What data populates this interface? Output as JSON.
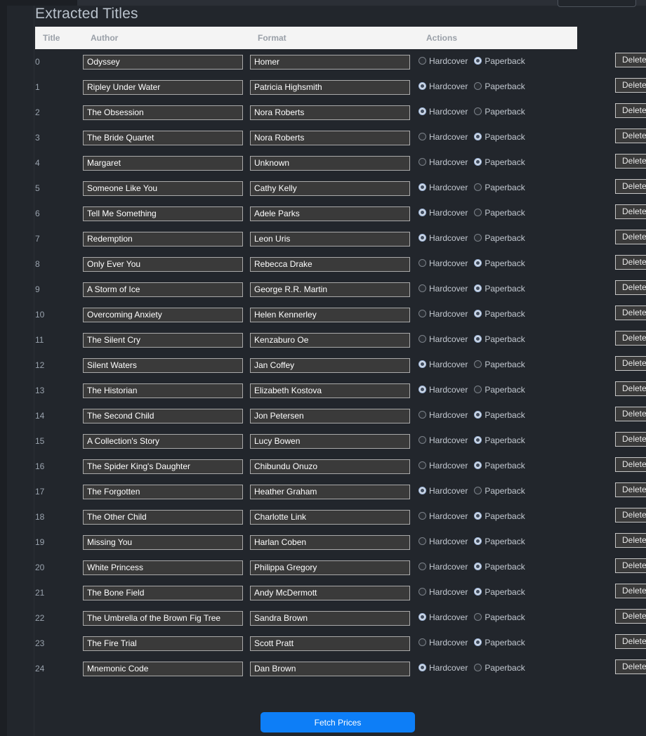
{
  "page": {
    "title": "Extracted Titles",
    "accent_color": "#0d7ef7",
    "background_color": "#22262c",
    "header_background": "#f4f4f4"
  },
  "table": {
    "columns": [
      "Title",
      "Author",
      "Format",
      "Actions"
    ],
    "format_options": [
      "Hardcover",
      "Paperback"
    ],
    "delete_label": "Delete",
    "rows": [
      {
        "index": "0",
        "title": "Odyssey",
        "author": "Homer",
        "format": "Paperback"
      },
      {
        "index": "1",
        "title": "Ripley Under Water",
        "author": "Patricia Highsmith",
        "format": "Hardcover"
      },
      {
        "index": "2",
        "title": "The Obsession",
        "author": "Nora Roberts",
        "format": "Hardcover"
      },
      {
        "index": "3",
        "title": "The Bride Quartet",
        "author": "Nora Roberts",
        "format": "Paperback"
      },
      {
        "index": "4",
        "title": "Margaret",
        "author": "Unknown",
        "format": "Paperback"
      },
      {
        "index": "5",
        "title": "Someone Like You",
        "author": "Cathy Kelly",
        "format": "Hardcover"
      },
      {
        "index": "6",
        "title": "Tell Me Something",
        "author": "Adele Parks",
        "format": "Hardcover"
      },
      {
        "index": "7",
        "title": "Redemption",
        "author": "Leon Uris",
        "format": "Hardcover"
      },
      {
        "index": "8",
        "title": "Only Ever You",
        "author": "Rebecca Drake",
        "format": "Paperback"
      },
      {
        "index": "9",
        "title": "A Storm of Ice",
        "author": "George R.R. Martin",
        "format": "Paperback"
      },
      {
        "index": "10",
        "title": "Overcoming Anxiety",
        "author": "Helen Kennerley",
        "format": "Paperback"
      },
      {
        "index": "11",
        "title": "The Silent Cry",
        "author": "Kenzaburo Oe",
        "format": "Paperback"
      },
      {
        "index": "12",
        "title": "Silent Waters",
        "author": "Jan Coffey",
        "format": "Hardcover"
      },
      {
        "index": "13",
        "title": "The Historian",
        "author": "Elizabeth Kostova",
        "format": "Hardcover"
      },
      {
        "index": "14",
        "title": "The Second Child",
        "author": "Jon Petersen",
        "format": "Paperback"
      },
      {
        "index": "15",
        "title": "A Collection's Story",
        "author": "Lucy Bowen",
        "format": "Paperback"
      },
      {
        "index": "16",
        "title": "The Spider King's Daughter",
        "author": "Chibundu Onuzo",
        "format": "Paperback"
      },
      {
        "index": "17",
        "title": "The Forgotten",
        "author": "Heather Graham",
        "format": "Hardcover"
      },
      {
        "index": "18",
        "title": "The Other Child",
        "author": "Charlotte Link",
        "format": "Paperback"
      },
      {
        "index": "19",
        "title": "Missing You",
        "author": "Harlan Coben",
        "format": "Paperback"
      },
      {
        "index": "20",
        "title": "White Princess",
        "author": "Philippa Gregory",
        "format": "Paperback"
      },
      {
        "index": "21",
        "title": "The Bone Field",
        "author": "Andy McDermott",
        "format": "Paperback"
      },
      {
        "index": "22",
        "title": "The Umbrella of the Brown Fig Tree",
        "author": "Sandra Brown",
        "format": "Hardcover"
      },
      {
        "index": "23",
        "title": "The Fire Trial",
        "author": "Scott Pratt",
        "format": "Paperback"
      },
      {
        "index": "24",
        "title": "Mnemonic Code",
        "author": "Dan Brown",
        "format": "Hardcover"
      }
    ]
  },
  "footer": {
    "fetch_prices_label": "Fetch Prices"
  }
}
